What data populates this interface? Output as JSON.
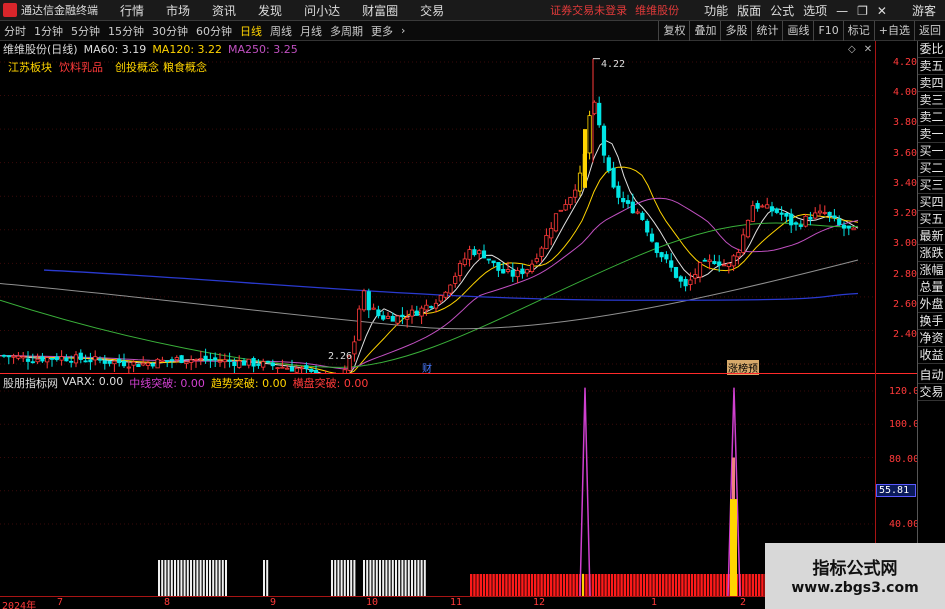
{
  "menubar": {
    "app_title": "通达信金融终端",
    "items": [
      "行情",
      "市场",
      "资讯",
      "发现",
      "问小达",
      "财富圈",
      "交易"
    ],
    "notice": "证券交易未登录",
    "notice2": "维维股份",
    "right_items": [
      "功能",
      "版面",
      "公式",
      "选项"
    ],
    "guest": "游客"
  },
  "toolbar": {
    "periods": [
      "分时",
      "1分钟",
      "5分钟",
      "15分钟",
      "30分钟",
      "60分钟",
      "日线",
      "周线",
      "月线",
      "多周期",
      "更多"
    ],
    "active": "日线",
    "right_buttons": [
      "复权",
      "叠加",
      "多股",
      "统计",
      "画线",
      "F10",
      "标记",
      "+自选",
      "返回"
    ]
  },
  "stock": {
    "name": "维维股份(日线)",
    "ma60": "MA60: 3.19",
    "ma120": "MA120: 3.22",
    "ma250": "MA250: 3.25"
  },
  "tags": [
    "江苏板块",
    "饮料乳品",
    "创投概念",
    "粮食概念"
  ],
  "indicator": {
    "name": "股朋指标网",
    "varx": "VARX: 0.00",
    "zx": "中线突破: 0.00",
    "qs": "趋势突破: 0.00",
    "hp": "横盘突破: 0.00"
  },
  "price_axis": [
    "4.20",
    "4.00",
    "3.80",
    "3.60",
    "3.40",
    "3.20",
    "3.00",
    "2.80",
    "2.60",
    "2.40"
  ],
  "ind_axis": [
    "120.0",
    "100.0",
    "80.00",
    "60.00",
    "40.00"
  ],
  "ind_current": "55.81",
  "price_labels": {
    "high": "4.22",
    "low": "2.26"
  },
  "events": {
    "cai": "财",
    "zhangting": "涨榜预"
  },
  "time_axis": [
    "2024年",
    "7",
    "8",
    "9",
    "10",
    "11",
    "12",
    "1",
    "2"
  ],
  "right_panel": [
    "委比",
    "卖五",
    "卖四",
    "卖三",
    "卖二",
    "卖一",
    "买一",
    "买二",
    "买三",
    "买四",
    "买五",
    "最新",
    "涨跌",
    "涨幅",
    "总量",
    "外盘",
    "换手",
    "净资",
    "收益",
    "自动",
    "交易"
  ],
  "watermark": {
    "line1": "指标公式网",
    "line2": "www.zbgs3.com"
  },
  "colors": {
    "up": "#ff3a3a",
    "down": "#00e5e5",
    "ma_white": "#e0e0e0",
    "ma_yellow": "#ffd400",
    "ma_purple": "#c050c0",
    "ma_green": "#3ab03a",
    "ma_blue": "#2a3ad0",
    "ma_gray": "#909090"
  }
}
